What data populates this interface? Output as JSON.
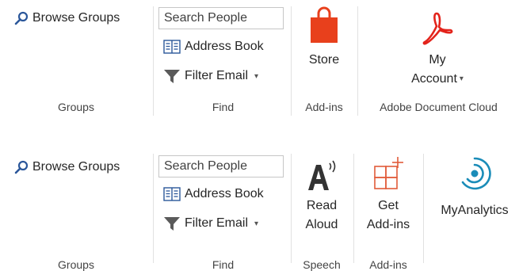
{
  "top": {
    "groups_section": {
      "browse_groups": "Browse Groups",
      "label": "Groups"
    },
    "find_section": {
      "search_placeholder": "Search People",
      "address_book": "Address Book",
      "filter_email": "Filter Email",
      "label": "Find"
    },
    "addins_section": {
      "store": "Store",
      "label": "Add-ins"
    },
    "adobe_section": {
      "my": "My",
      "account": "Account",
      "label": "Adobe Document Cloud"
    }
  },
  "bottom": {
    "groups_section": {
      "browse_groups": "Browse Groups",
      "label": "Groups"
    },
    "find_section": {
      "search_placeholder": "Search People",
      "address_book": "Address Book",
      "filter_email": "Filter Email",
      "label": "Find"
    },
    "speech_section": {
      "read": "Read",
      "aloud": "Aloud",
      "label": "Speech"
    },
    "addins_section": {
      "get": "Get",
      "addins": "Add-ins",
      "label": "Add-ins"
    },
    "analytics_section": {
      "label": "MyAnalytics"
    }
  },
  "colors": {
    "accent_blue": "#2b579a",
    "store_orange": "#e8401c",
    "adobe_red": "#e3231b",
    "addin_red": "#e15c3a",
    "analytics_teal": "#1a8cb8"
  },
  "icons": [
    "search-icon",
    "address-book-icon",
    "filter-icon",
    "store-bag-icon",
    "adobe-acrobat-icon",
    "read-aloud-icon",
    "get-addins-icon",
    "myanalytics-icon"
  ]
}
